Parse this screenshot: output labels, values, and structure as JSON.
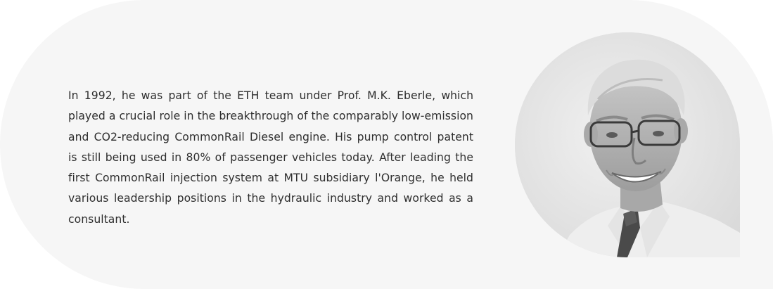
{
  "bio": {
    "text": "In 1992, he was part of the ETH team under Prof. M.K. Eberle, which played a crucial role in the breakthrough of the comparably low-emission and CO2-reducing CommonRail Diesel engine. His pump control patent is still being used in 80% of passenger vehicles today. After leading the first CommonRail injection system at MTU subsidiary l'Orange, he held various leadership positions in the hydraulic industry and worked as a consultant."
  },
  "portrait": {
    "icon": "person-photo"
  }
}
